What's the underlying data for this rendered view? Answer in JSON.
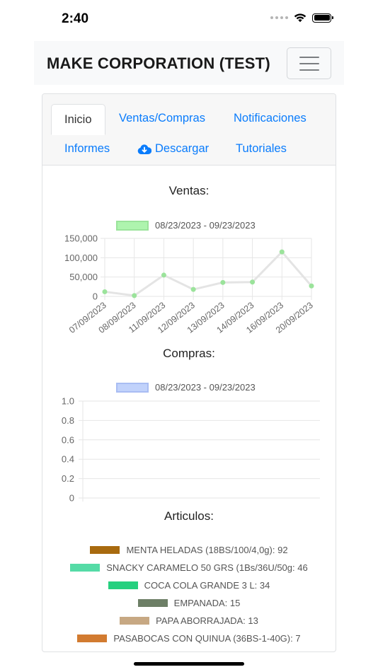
{
  "status_bar": {
    "time": "2:40",
    "icons": [
      "cellular-signal-icon",
      "wifi-icon",
      "battery-icon"
    ]
  },
  "navbar": {
    "brand": "MAKE CORPORATION (TEST)",
    "menu_icon": "hamburger-menu-icon"
  },
  "tabs": {
    "inicio": "Inicio",
    "ventas_compras": "Ventas/Compras",
    "notificaciones": "Notificaciones",
    "informes": "Informes",
    "descargar": "Descargar",
    "descargar_icon": "cloud-download-icon",
    "tutoriales": "Tutoriales"
  },
  "colors": {
    "link": "#0a7cfc",
    "ventas_line": "#e4e4e4",
    "ventas_point": "#9be39b",
    "compras_legend": "#b4c6f7"
  },
  "chart_data": [
    {
      "type": "line",
      "title": "Ventas:",
      "series": [
        {
          "name": "08/23/2023 - 09/23/2023",
          "x": [
            "07/09/2023",
            "08/09/2023",
            "11/09/2023",
            "12/09/2023",
            "13/09/2023",
            "14/09/2023",
            "16/09/2023",
            "20/09/2023"
          ],
          "values": [
            12000,
            2000,
            55000,
            18000,
            36000,
            37000,
            115000,
            27000
          ]
        }
      ],
      "ylim": [
        0,
        150000
      ],
      "yticks": [
        "150,000",
        "100,000",
        "50,000",
        "0"
      ],
      "grid": true,
      "legend_position": "top"
    },
    {
      "type": "line",
      "title": "Compras:",
      "series": [
        {
          "name": "08/23/2023 - 09/23/2023",
          "x": [],
          "values": []
        }
      ],
      "ylim": [
        0,
        1
      ],
      "yticks": [
        "1.0",
        "0.8",
        "0.6",
        "0.4",
        "0.2",
        "0"
      ],
      "grid": true,
      "legend_position": "top"
    },
    {
      "type": "pie",
      "title": "Articulos:",
      "labels": [
        "MENTA HELADAS (18BS/100/4,0g): 92",
        "SNACKY CARAMELO 50 GRS (1Bs/36U/50g: 46",
        "COCA COLA GRANDE 3 L: 34",
        "EMPANADA: 15",
        "PAPA ABORRAJADA: 13",
        "PASABOCAS CON QUINUA (36BS-1-40G): 7"
      ],
      "values": [
        92,
        46,
        34,
        15,
        13,
        7
      ],
      "colors": [
        "#a86a0f",
        "#55dba6",
        "#26d07f",
        "#6d7f66",
        "#c7a883",
        "#d27b30"
      ],
      "legend_position": "top"
    }
  ]
}
